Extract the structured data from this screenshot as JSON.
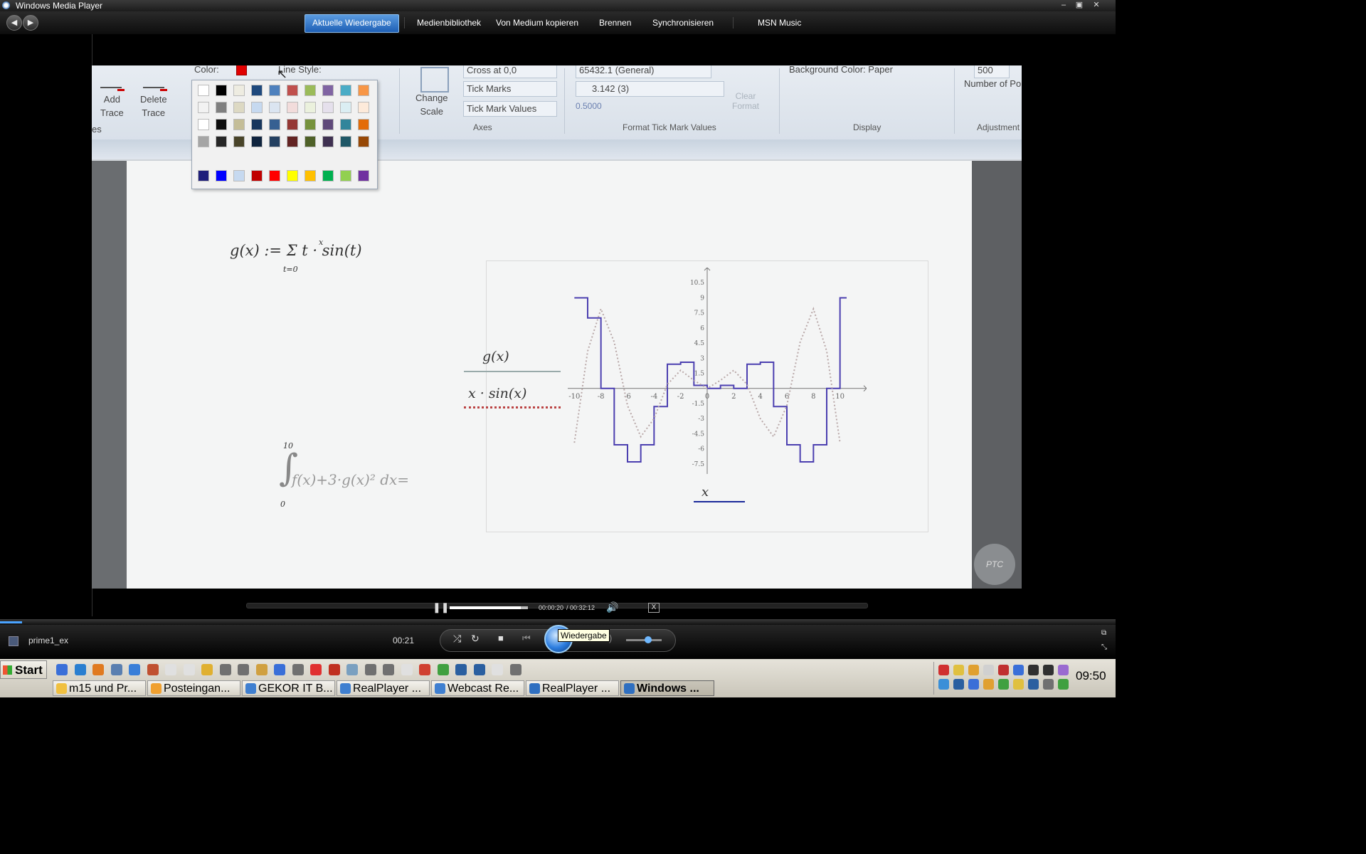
{
  "window": {
    "title": "Windows Media Player"
  },
  "nav": {
    "tabs": [
      {
        "label": "Aktuelle Wiedergabe"
      },
      {
        "label": "Medienbibliothek"
      },
      {
        "label": "Von Medium kopieren"
      },
      {
        "label": "Brennen"
      },
      {
        "label": "Synchronisieren"
      },
      {
        "label": "MSN Music"
      }
    ]
  },
  "video": {
    "ribbon": {
      "add_trace": "Add\nTrace",
      "delete_trace": "Delete\nTrace",
      "color_label": "Color:",
      "line_style_label": "Line Style:",
      "traces_group": "es",
      "change_scale": "Change\nScale",
      "cross_at": "Cross at 0,0",
      "tick_marks": "Tick Marks",
      "tick_mark_values": "Tick Mark Values",
      "axes_group": "Axes",
      "format_general": "65432.1 (General)",
      "format_value": "3.142 (3)",
      "format_sample": "0.5000",
      "clear_format": "Clear\nFormat",
      "format_group": "Format Tick Mark Values",
      "background_color": "Background Color:  Paper",
      "display_group": "Display",
      "number_of": "Number of Po",
      "number_value": "500",
      "adjustment_group": "Adjustment"
    },
    "palette_colors": [
      [
        "#ffffff",
        "#000000",
        "#eeece1",
        "#1f497d",
        "#4f81bd",
        "#c0504d",
        "#9bbb59",
        "#8064a2",
        "#4bacc6",
        "#f79646"
      ],
      [
        "#f2f2f2",
        "#7f7f7f",
        "#ddd9c3",
        "#c6d9f0",
        "#dbe5f1",
        "#f2dcdb",
        "#ebf1dd",
        "#e5e0ec",
        "#dbeef3",
        "#fdeada"
      ],
      [
        "#ffffff",
        "#0d0d0d",
        "#c4bd97",
        "#17365d",
        "#366092",
        "#953734",
        "#76923c",
        "#5f497a",
        "#31859b",
        "#e36c09"
      ],
      [
        "#a5a5a5",
        "#262626",
        "#494429",
        "#0f243e",
        "#244061",
        "#632423",
        "#4f6128",
        "#3f3151",
        "#205867",
        "#974806"
      ],
      [
        "#1f1f7a",
        "#0000ff",
        "#c6d9f0",
        "#c00000",
        "#ff0000",
        "#ffff00",
        "#ffc000",
        "#00b050",
        "#92d050",
        "#7030a0"
      ]
    ],
    "math": {
      "g_def": "g(x) := Σ t · sin(t)",
      "sum_top": "x",
      "sum_bottom": "t=0",
      "integral": "f(x)+3·g(x)² dx=",
      "int_top": "10",
      "int_bottom": "0",
      "legend_g": "g(x)",
      "legend_xsin": "x · sin(x)",
      "x_axis_label": "x"
    },
    "watermark": "PTC"
  },
  "chart_data": {
    "type": "line",
    "title": "",
    "xlabel": "x",
    "ylabel": "",
    "xlim": [
      -10.5,
      12
    ],
    "ylim": [
      -8.5,
      12
    ],
    "x_ticks": [
      "-10",
      "-8",
      "-6",
      "-4",
      "-2",
      "0",
      "2",
      "4",
      "6",
      "8",
      "10"
    ],
    "y_ticks": [
      "10.5",
      "9",
      "7.5",
      "6",
      "4.5",
      "3",
      "1.5",
      "-1.5",
      "-3",
      "-4.5",
      "-6",
      "-7.5"
    ],
    "series": [
      {
        "name": "g(x)",
        "color": "#4b3fb0",
        "style": "step",
        "x": [
          -10,
          -9,
          -8,
          -7,
          -6,
          -5,
          -4,
          -3,
          -2,
          -1,
          0,
          1,
          2,
          3,
          4,
          5,
          6,
          7,
          8,
          9,
          10
        ],
        "y": [
          9.0,
          7.0,
          0.0,
          -5.6,
          -7.3,
          -5.6,
          -1.8,
          2.4,
          2.6,
          0.3,
          0.0,
          0.3,
          0.0,
          2.4,
          2.6,
          -1.8,
          -5.6,
          -7.3,
          -5.6,
          0.0,
          9.0
        ]
      },
      {
        "name": "x · sin(x)",
        "color": "#b9a8a8",
        "style": "dotted",
        "x": [
          -10,
          -9,
          -8,
          -7,
          -6,
          -5,
          -4,
          -3,
          -2,
          -1,
          0,
          1,
          2,
          3,
          4,
          5,
          6,
          7,
          8,
          9,
          10
        ],
        "y": [
          -5.4,
          3.7,
          7.9,
          4.6,
          -1.7,
          -4.8,
          -3.0,
          0.4,
          1.8,
          0.8,
          0.0,
          0.8,
          1.8,
          0.4,
          -3.0,
          -4.8,
          -1.7,
          4.6,
          7.9,
          3.7,
          -5.4
        ]
      }
    ],
    "grid": false,
    "legend": "left"
  },
  "controls": {
    "time_current": "00:00:20",
    "time_total": "/ 00:32:12",
    "clip_progress": 0.91,
    "overall_progress": 0.02,
    "media_name": "prime1_ex",
    "elapsed": "00:21",
    "tooltip": "Wiedergabe",
    "volume": 0.62
  },
  "taskbar": {
    "start": "Start",
    "buttons": [
      {
        "label": "m15 und Pr...",
        "color": "#f0c040"
      },
      {
        "label": "Posteingan...",
        "color": "#f0a030"
      },
      {
        "label": "GEKOR IT B...",
        "color": "#3f7fd0"
      },
      {
        "label": "RealPlayer ...",
        "color": "#3f7fd0"
      },
      {
        "label": "Webcast Re...",
        "color": "#3f7fd0"
      },
      {
        "label": "RealPlayer ...",
        "color": "#2f6fc0"
      },
      {
        "label": "Windows ...",
        "color": "#2f6fc0"
      }
    ],
    "clock": "09:50"
  }
}
